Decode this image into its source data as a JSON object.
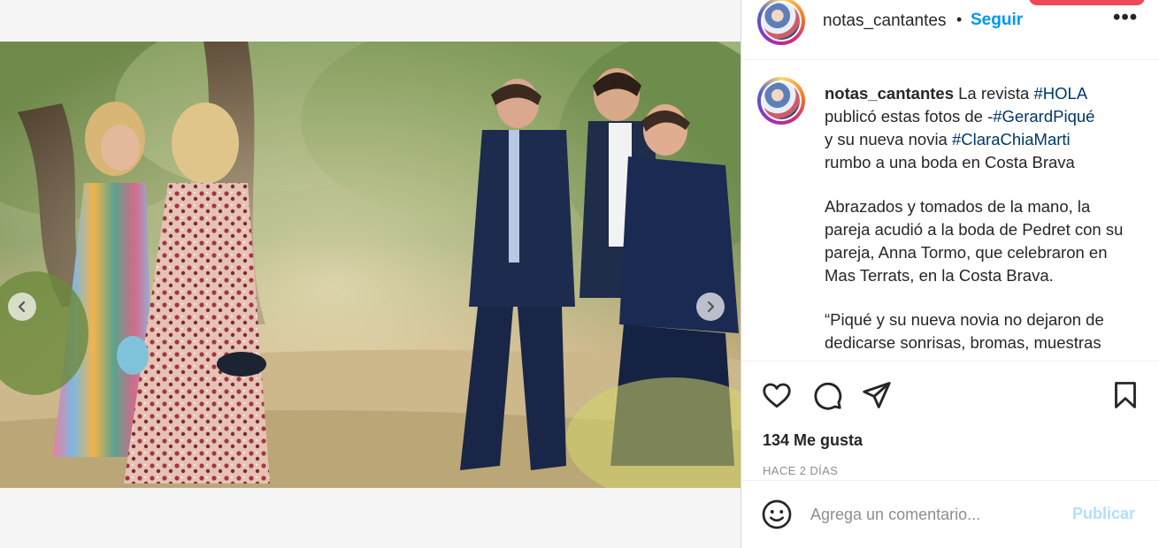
{
  "post": {
    "username": "notas_cantantes",
    "separator": "•",
    "follow_label": "Seguir",
    "more_label": "•••"
  },
  "caption": {
    "username": "notas_cantantes",
    "line1_text": " La revista ",
    "tag_hola": "#HOLA",
    "line2_text": "publicó estas fotos de -",
    "tag_pique": "#GerardPiqué",
    "line3_text": "y su nueva novia ",
    "tag_clara": "#ClaraChiaMarti",
    "line4_text": "rumbo a una boda en Costa Brava",
    "paragraph2": "Abrazados y tomados de la mano, la pareja acudió a la boda de Pedret con su pareja, Anna Tormo, que celebraron en Mas Terrats, en la Costa Brava.",
    "paragraph3": "“Piqué y su nueva novia no dejaron de dedicarse sonrisas, bromas, muestras"
  },
  "carousel": {
    "slide_count": 6,
    "active_index": 1
  },
  "stats": {
    "likes": "134 Me gusta",
    "time_ago": "HACE 2 DÍAS"
  },
  "comment": {
    "placeholder": "Agrega un comentario...",
    "publish_label": "Publicar"
  },
  "icons": {
    "prev": "chevron-left-icon",
    "next": "chevron-right-icon",
    "like": "heart-icon",
    "comment": "comment-icon",
    "share": "paper-plane-icon",
    "save": "bookmark-icon",
    "emoji": "smiley-icon"
  },
  "colors": {
    "accent": "#0095f6",
    "publish_disabled": "#b2dffc",
    "hashtag": "#00376b",
    "notification": "#ed4956"
  }
}
